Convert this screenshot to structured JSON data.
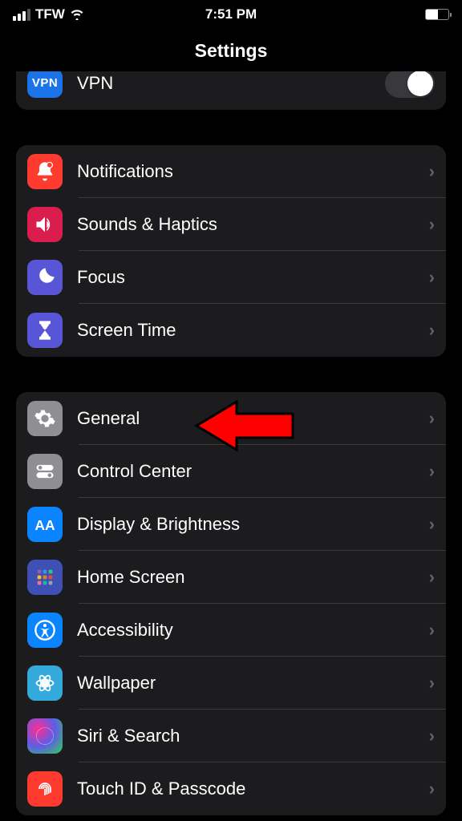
{
  "status_bar": {
    "carrier": "TFW",
    "time": "7:51 PM"
  },
  "header": {
    "title": "Settings"
  },
  "group_vpn": {
    "vpn": {
      "label": "VPN"
    }
  },
  "group_notifications": {
    "items": [
      {
        "label": "Notifications"
      },
      {
        "label": "Sounds & Haptics"
      },
      {
        "label": "Focus"
      },
      {
        "label": "Screen Time"
      }
    ]
  },
  "group_general": {
    "items": [
      {
        "label": "General"
      },
      {
        "label": "Control Center"
      },
      {
        "label": "Display & Brightness"
      },
      {
        "label": "Home Screen"
      },
      {
        "label": "Accessibility"
      },
      {
        "label": "Wallpaper"
      },
      {
        "label": "Siri & Search"
      },
      {
        "label": "Touch ID & Passcode"
      }
    ]
  },
  "colors": {
    "vpn": "#1a73e8",
    "notifications": "#ff3b30",
    "sounds": "#d91e4e",
    "focus": "#5856d6",
    "screentime": "#5856d6",
    "general": "#8e8e93",
    "control": "#8e8e93",
    "display": "#0a84ff",
    "home": "#3e50b4",
    "accessibility": "#0a84ff",
    "wallpaper": "#34aadc",
    "siri": "#1c1c2e",
    "touchid": "#ff3b30"
  }
}
